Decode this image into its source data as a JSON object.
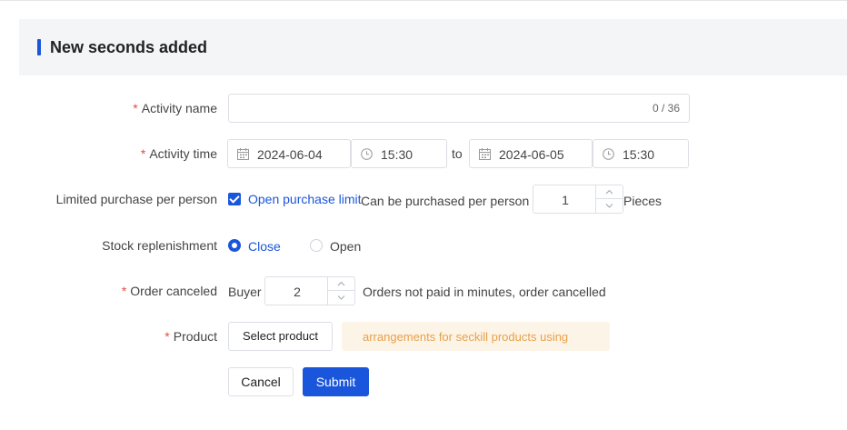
{
  "header": {
    "title": "New seconds added"
  },
  "form": {
    "activity_name": {
      "label": "Activity name",
      "required": "*",
      "value": "",
      "count": "0 / 36"
    },
    "activity_time": {
      "label": "Activity time",
      "required": "*",
      "start_date": "2024-06-04",
      "start_time": "15:30",
      "separator": "to",
      "end_date": "2024-06-05",
      "end_time": "15:30"
    },
    "limited_purchase": {
      "label": "Limited purchase per person",
      "checkbox_label": "Open purchase limit",
      "prefix": "Can be purchased per person",
      "quantity": "1",
      "suffix": "Pieces"
    },
    "stock_replenishment": {
      "label": "Stock replenishment",
      "options": [
        "Close",
        "Open"
      ],
      "selected": "Close"
    },
    "order_canceled": {
      "label": "Order canceled",
      "required": "*",
      "prefix": "Buyer",
      "minutes": "2",
      "suffix": "Orders not paid in minutes, order cancelled"
    },
    "product": {
      "label": "Product",
      "required": "*",
      "button": "Select product",
      "tip": "arrangements for seckill products using"
    },
    "actions": {
      "cancel": "Cancel",
      "submit": "Submit"
    }
  },
  "icons": {
    "calendar": "calendar-icon",
    "clock": "clock-icon",
    "up": "chevron-up-icon",
    "down": "chevron-down-icon"
  },
  "colors": {
    "accent": "#1a56db",
    "required": "#e74c3c",
    "tip_text": "#e8a047",
    "tip_bg": "#fdf4e8"
  }
}
